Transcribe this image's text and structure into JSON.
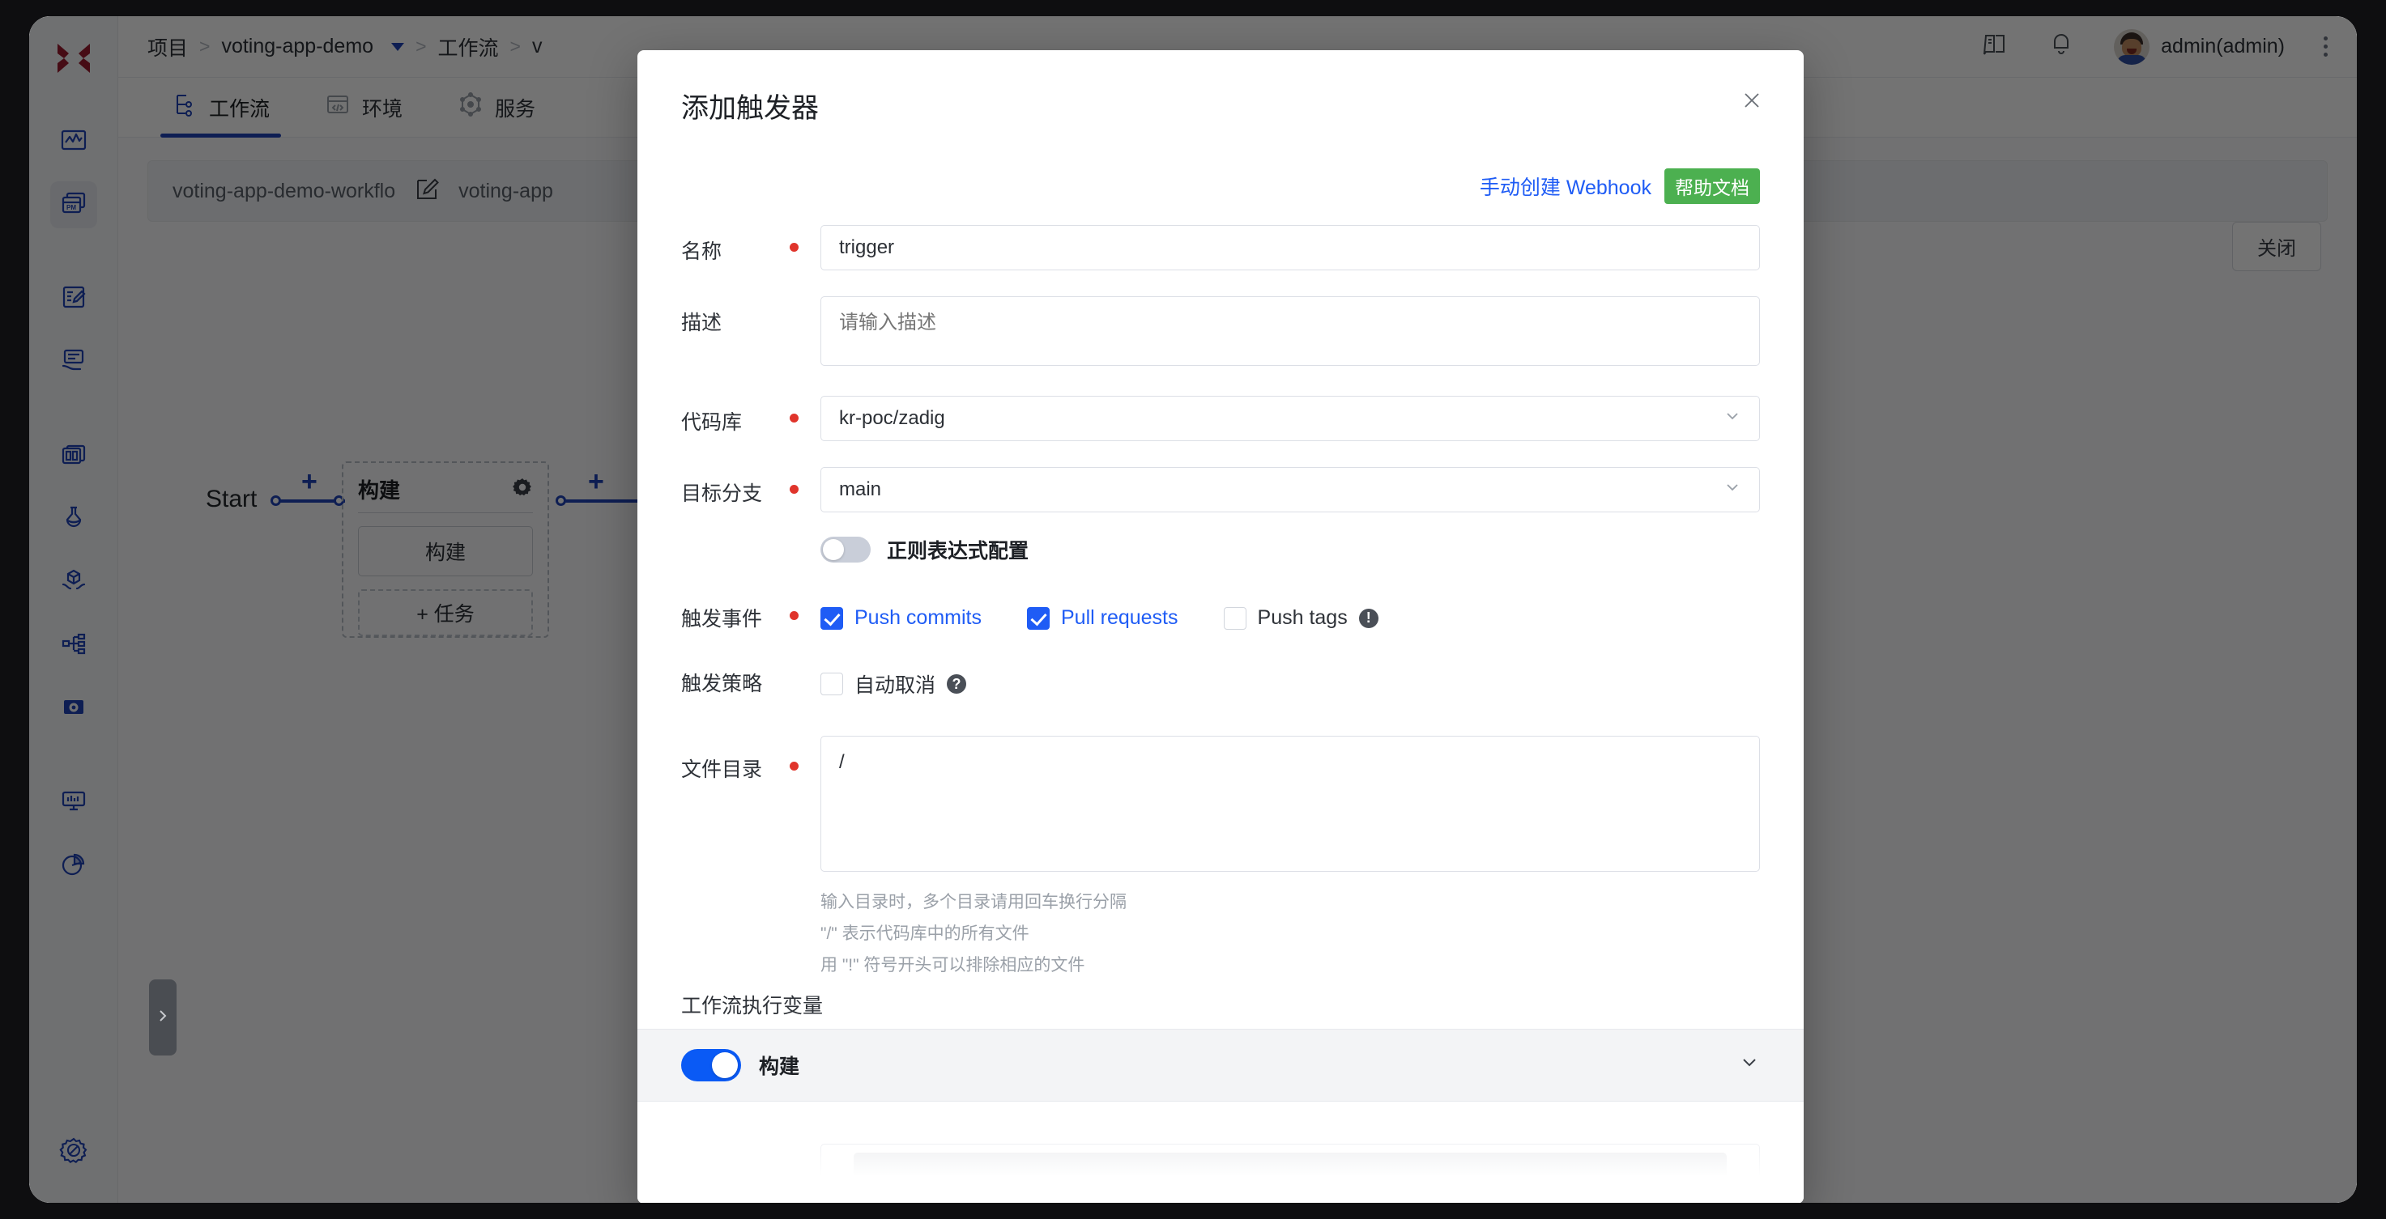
{
  "app": {
    "breadcrumb": [
      {
        "label": "项目",
        "type": "link"
      },
      {
        "label": ">",
        "type": "sep"
      },
      {
        "label": "voting-app-demo",
        "type": "dropdown"
      },
      {
        "label": ">",
        "type": "sep"
      },
      {
        "label": "工作流",
        "type": "link"
      },
      {
        "label": ">",
        "type": "sep"
      },
      {
        "label": "v",
        "type": "text"
      }
    ],
    "username": "admin(admin)",
    "tabs": [
      {
        "label": "工作流",
        "icon": "workflow-icon",
        "active": true
      },
      {
        "label": "环境",
        "icon": "code-window-icon",
        "active": false
      },
      {
        "label": "服务",
        "icon": "service-node-icon",
        "active": false
      }
    ],
    "workflow": {
      "name": "voting-app-demo-workflo",
      "name_secondary": "voting-app",
      "edit_icon": "edit-square-icon",
      "close_label": "关闭"
    },
    "canvas": {
      "start_label": "Start",
      "node_title": "构建",
      "node_gear_icon": "gear-icon",
      "node_stage_label": "构建",
      "node_add_task_label": "+ 任务",
      "plus_label": "+"
    },
    "rail": [
      {
        "name": "logo",
        "icon": "x-logo"
      },
      {
        "name": "dashboard",
        "icon": "activity-chart-icon",
        "active": false
      },
      {
        "name": "projects",
        "icon": "pm-cards-icon",
        "active": true
      },
      {
        "name": "editor",
        "icon": "edit-note-icon",
        "active": false
      },
      {
        "name": "delivery",
        "icon": "deliver-message-icon",
        "active": false
      },
      {
        "name": "templates",
        "icon": "dashboard-grid-icon",
        "active": false
      },
      {
        "name": "testing",
        "icon": "flask-icon",
        "active": false
      },
      {
        "name": "artifacts",
        "icon": "package-hands-icon",
        "active": false
      },
      {
        "name": "resources",
        "icon": "sliders-icon",
        "active": false
      },
      {
        "name": "system-config",
        "icon": "box-gear-icon",
        "active": false
      },
      {
        "name": "monitor",
        "icon": "monitor-chart-icon",
        "active": false
      },
      {
        "name": "reports",
        "icon": "pie-chart-icon",
        "active": false
      },
      {
        "name": "settings",
        "icon": "settings-gear-icon",
        "active": false
      }
    ],
    "panel_handle_icon": "chevron-right-icon"
  },
  "modal": {
    "title": "添加触发器",
    "close_icon": "close-icon",
    "webhook": {
      "link_label": "手动创建 Webhook",
      "badge_label": "帮助文档",
      "badge_color": "#4cb050",
      "link_color": "#1f5cf5"
    },
    "fields": {
      "name": {
        "label": "名称",
        "value": "trigger",
        "required": true
      },
      "description": {
        "label": "描述",
        "value": "",
        "placeholder": "请输入描述",
        "required": false
      },
      "repo": {
        "label": "代码库",
        "value": "kr-poc/zadig",
        "required": true,
        "chevron": "chevron-down-icon"
      },
      "branch": {
        "label": "目标分支",
        "value": "main",
        "required": true,
        "chevron": "chevron-down-icon"
      },
      "regex_toggle": {
        "label": "正则表达式配置",
        "on": false
      },
      "events": {
        "label": "触发事件",
        "required": true,
        "items": [
          {
            "label": "Push commits",
            "checked": true,
            "info": false
          },
          {
            "label": "Pull requests",
            "checked": true,
            "info": false
          },
          {
            "label": "Push tags",
            "checked": false,
            "info": true,
            "info_icon": "exclamation-circle-icon"
          }
        ]
      },
      "strategy": {
        "label": "触发策略",
        "items": [
          {
            "label": "自动取消",
            "checked": false,
            "info": true,
            "info_icon": "question-circle-icon"
          }
        ]
      },
      "file_dir": {
        "label": "文件目录",
        "required": true,
        "value": "/",
        "hints": [
          "输入目录时，多个目录请用回车换行分隔",
          "\"/\" 表示代码库中的所有文件",
          "用 \"!\" 符号开头可以排除相应的文件"
        ]
      }
    },
    "variables": {
      "section_title": "工作流执行变量",
      "row": {
        "label": "构建",
        "toggle_on": true,
        "chevron": "chevron-down-icon"
      }
    }
  },
  "colors": {
    "primary_blue": "#1f5cf5",
    "nav_blue": "#1f44b8",
    "required_red": "#e0342b",
    "badge_green": "#4cb050",
    "logo_red": "#9b1b30"
  }
}
